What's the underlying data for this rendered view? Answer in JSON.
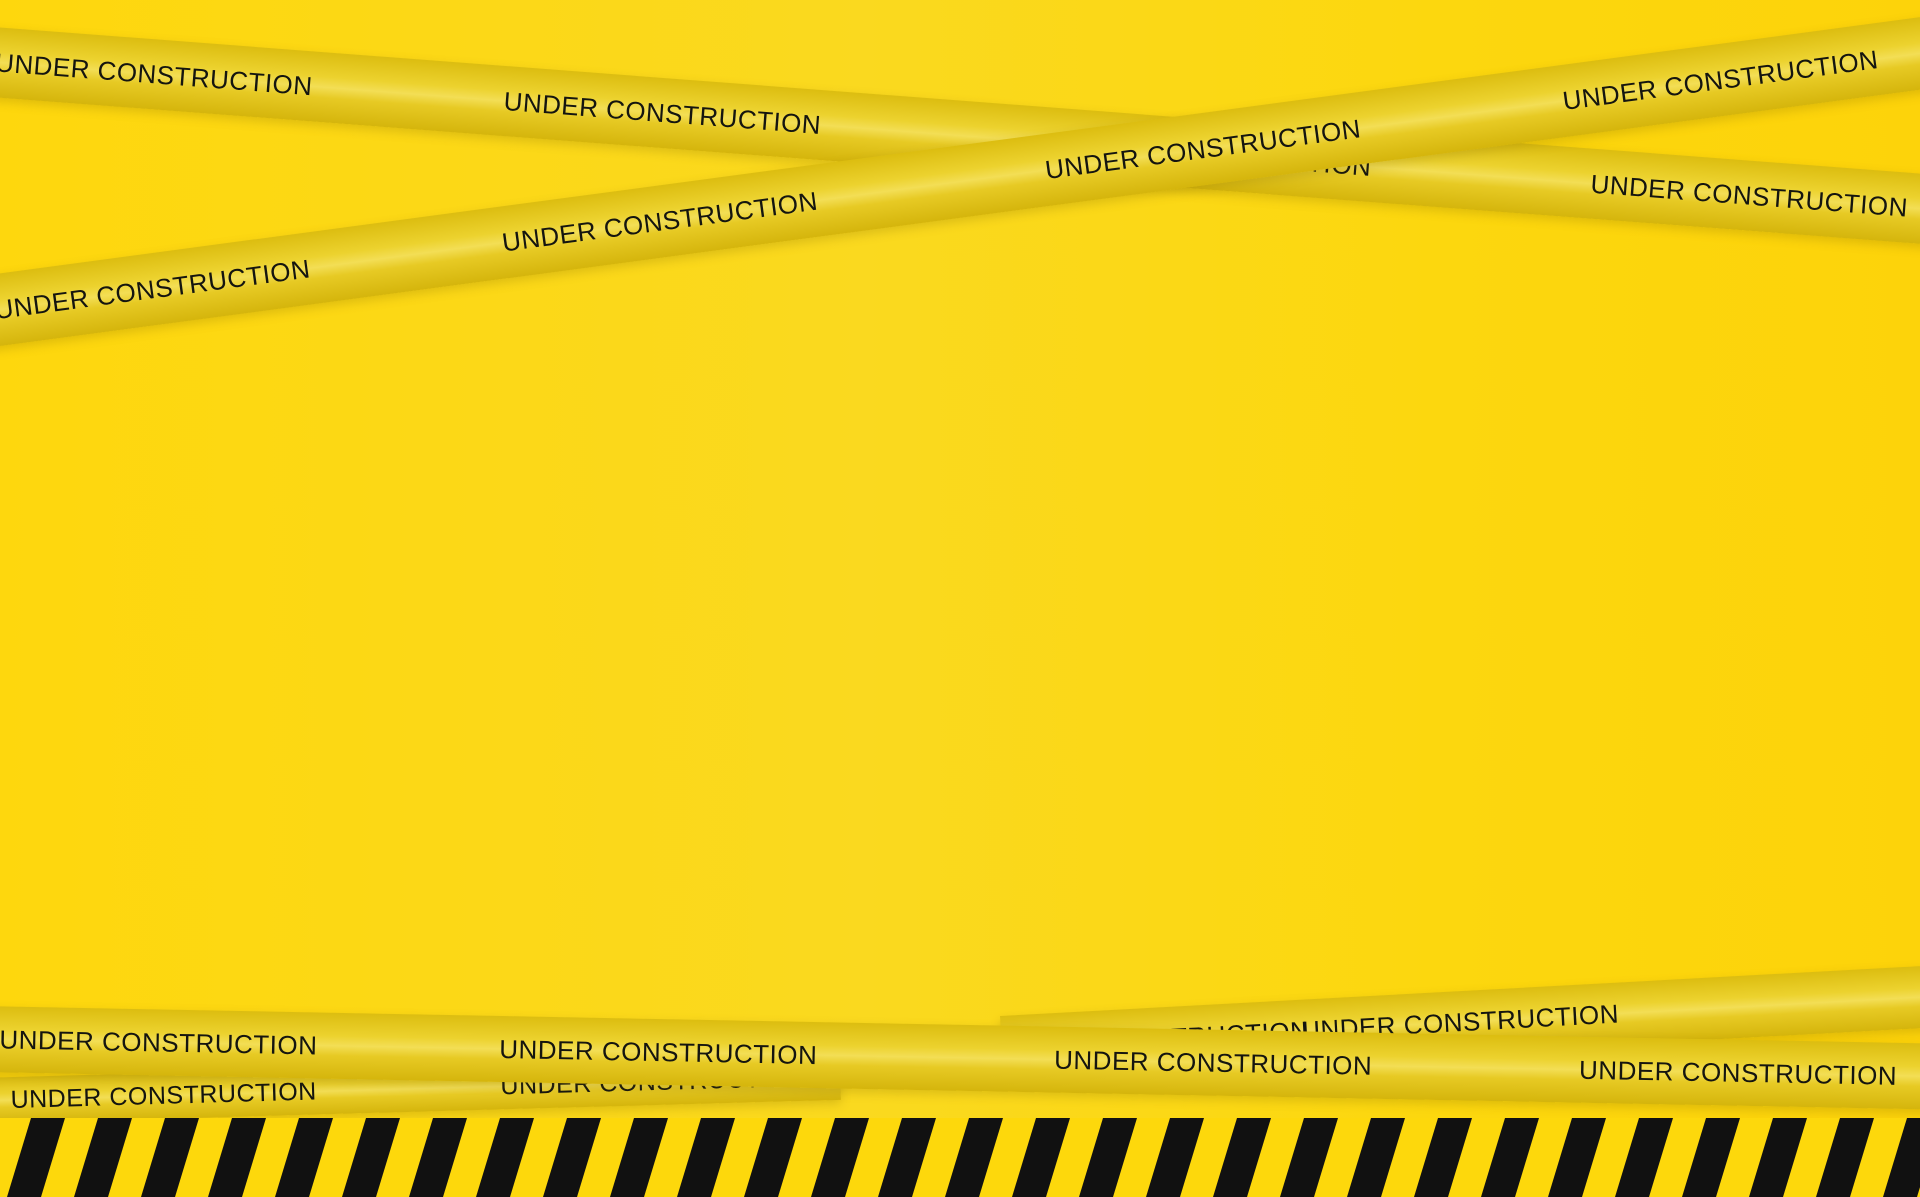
{
  "colors": {
    "background": "#fcd70e",
    "tape": "#e7ca24",
    "text": "#15150f",
    "hazard_dark": "#111111",
    "hazard_light": "#fdd80c"
  },
  "tapes": [
    {
      "id": "top-left-down",
      "labels": [
        "UNDER CONSTRUCTION",
        "UNDER CONSTRUCTION",
        "UNDER CONSTRUCTION",
        "UNDER CONSTRUCTION"
      ]
    },
    {
      "id": "top-left-up",
      "labels": [
        "UNDER CONSTRUCTION",
        "UNDER CONSTRUCTION",
        "UNDER CONSTRUCTION",
        "UNDER CONSTRUCTION"
      ]
    },
    {
      "id": "bottom-upper",
      "labels": [
        "UNDER CONSTRUCTION",
        "UNDER CONSTRUCTION"
      ]
    },
    {
      "id": "bottom-main",
      "labels": [
        "UNDER CONSTRUCTION",
        "UNDER CONSTRUCTION",
        "UNDER CONSTRUCTION",
        "UNDER CONSTRUCTION"
      ]
    },
    {
      "id": "bottom-lower",
      "labels": [
        "UNDER CONSTRUCTION",
        "UNDER CONSTRUCTION"
      ]
    }
  ]
}
